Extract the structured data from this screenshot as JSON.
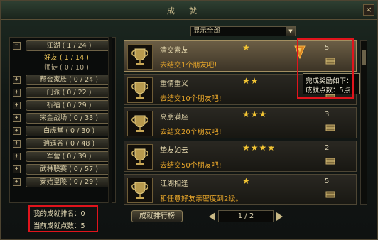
{
  "window": {
    "title": "成就",
    "close_label": "×"
  },
  "categories": [
    {
      "label": "江湖 ( 1 / 24 )",
      "toggle": "−",
      "expanded": true,
      "children": [
        {
          "label": "好友 ( 1 / 14 )",
          "active": true
        },
        {
          "label": "师徒 ( 0 / 10 )",
          "active": false
        }
      ]
    },
    {
      "label": "帮会家族 ( 0 / 24 )",
      "toggle": "+"
    },
    {
      "label": "门派 ( 0 / 22 )",
      "toggle": "+"
    },
    {
      "label": "祈福 ( 0 / 29 )",
      "toggle": "+"
    },
    {
      "label": "宋金战场 ( 0 / 33 )",
      "toggle": "+"
    },
    {
      "label": "白虎堂 ( 0 / 30 )",
      "toggle": "+"
    },
    {
      "label": "逍遥谷 ( 0 / 48 )",
      "toggle": "+"
    },
    {
      "label": "军营 ( 0 / 39 )",
      "toggle": "+"
    },
    {
      "label": "武林联赛 ( 0 / 57 )",
      "toggle": "+"
    },
    {
      "label": "秦始皇陵 ( 0 / 29 )",
      "toggle": "+"
    }
  ],
  "stats": {
    "rank_label": "我的成就排名：0",
    "points_label": "当前成就点数：5"
  },
  "filter": {
    "selected": "显示全部"
  },
  "achievements": [
    {
      "name": "清交素友",
      "stars": "★",
      "desc": "去结交1个朋友吧!",
      "points": "5",
      "selected": true
    },
    {
      "name": "重情重义",
      "stars": "★★",
      "desc": "去结交10个朋友吧!",
      "points": "",
      "selected": false
    },
    {
      "name": "高朋满座",
      "stars": "★★★",
      "desc": "去结交20个朋友吧!",
      "points": "3",
      "selected": false
    },
    {
      "name": "挚友如云",
      "stars": "★★★★",
      "desc": "去结交50个朋友吧!",
      "points": "2",
      "selected": false
    },
    {
      "name": "江湖相逢",
      "stars": "★",
      "desc": "和任意好友亲密度到2级。",
      "points": "5",
      "selected": false
    }
  ],
  "tooltip": {
    "line1": "完成奖励如下：",
    "line2": "成就点数：5点"
  },
  "bottom": {
    "rank_button": "成就排行榜",
    "page": "1 / 2"
  },
  "colors": {
    "highlight": "#e0141c",
    "star": "#f3c534",
    "desc": "#e6a52a"
  }
}
